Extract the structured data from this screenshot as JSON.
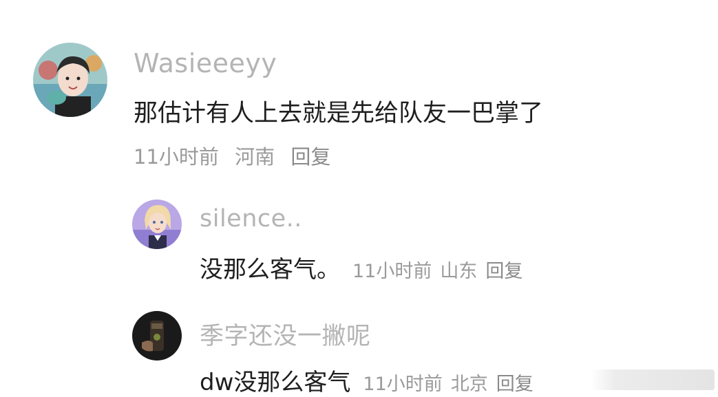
{
  "comments": [
    {
      "username": "Wasieeeyy",
      "content": "那估计有人上去就是先给队友一巴掌了",
      "time": "11小时前",
      "location": "河南",
      "reply_label": "回复"
    }
  ],
  "replies": [
    {
      "username": "silence..",
      "content": "没那么客气。",
      "time": "11小时前",
      "location": "山东",
      "reply_label": "回复"
    },
    {
      "username": "季字还没一撇呢",
      "content": "dw没那么客气",
      "time": "11小时前",
      "location": "北京",
      "reply_label": "回复"
    }
  ],
  "colors": {
    "username": "#b4b4b4",
    "content": "#1e1e1e",
    "meta": "#9a9a9a",
    "background": "#ffffff"
  }
}
